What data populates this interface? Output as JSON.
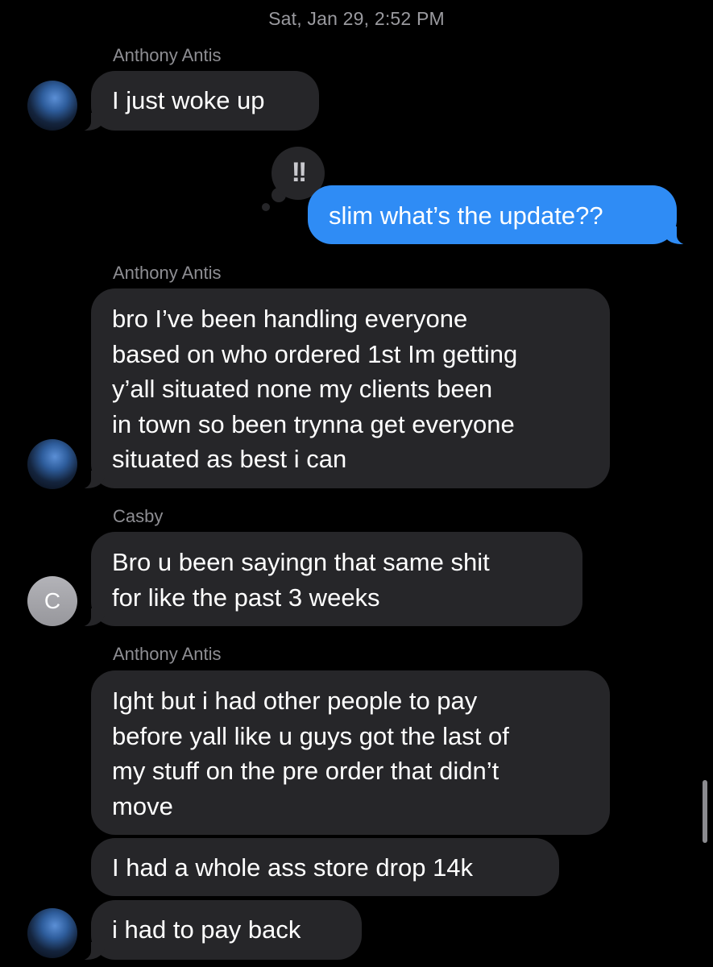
{
  "timestamp": "Sat, Jan 29, 2:52 PM",
  "tapback": "!!",
  "colors": {
    "incoming_bubble": "#262629",
    "outgoing_bubble": "#2f8cf5",
    "background": "#000000"
  },
  "messages": [
    {
      "sender": "Anthony Antis",
      "lines": [
        "I just woke up"
      ]
    },
    {
      "sender": "",
      "lines": [
        "slim what’s the update??"
      ]
    },
    {
      "sender": "Anthony Antis",
      "lines": [
        "bro I’ve been handling everyone",
        "based on who ordered 1st Im getting",
        "y’all situated none my clients been",
        "in town so been trynna get everyone",
        "situated as best i can"
      ]
    },
    {
      "sender": "Casby",
      "lines": [
        "Bro u been sayingn that same shit",
        "for like the past 3 weeks"
      ]
    },
    {
      "sender": "Anthony Antis",
      "lines": [
        "Ight but i had other people to pay",
        "before yall like u guys got the last of",
        "my stuff on the pre order that didn’t",
        "move"
      ]
    },
    {
      "sender": "",
      "lines": [
        "I had a whole ass store drop 14k"
      ]
    },
    {
      "sender": "",
      "lines": [
        "i had to pay back"
      ]
    }
  ],
  "avatars": {
    "casby_letter": "C"
  }
}
